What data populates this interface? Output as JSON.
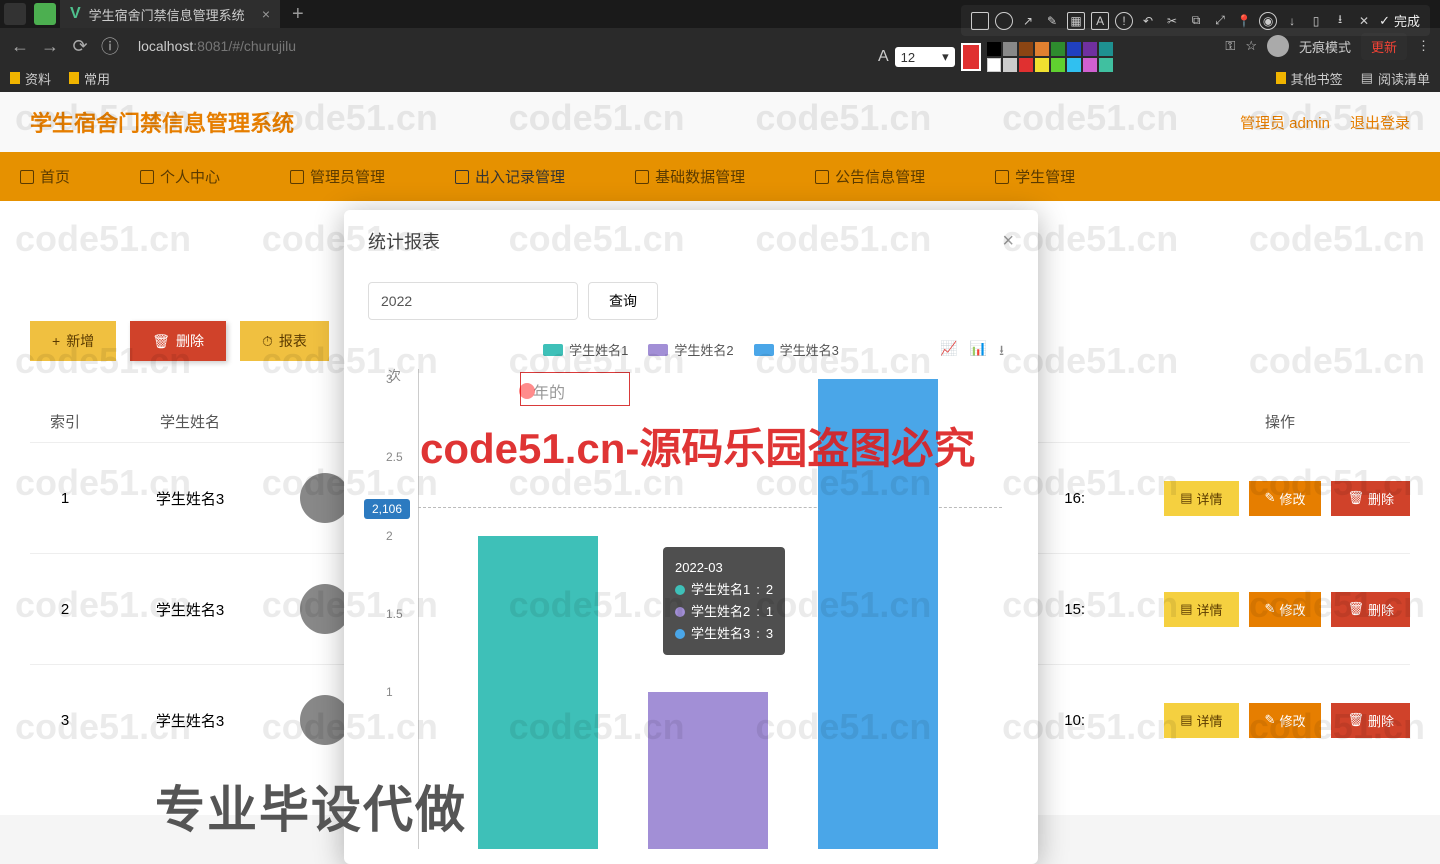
{
  "browser": {
    "tab_title": "学生宿舍门禁信息管理系统",
    "url_host": "localhost",
    "url_port": ":8081",
    "url_path": "/#/churujilu",
    "incognito": "无痕模式",
    "update": "更新",
    "bookmarks": [
      "资料",
      "常用"
    ],
    "right_bookmarks": [
      "其他书签",
      "阅读清单"
    ],
    "toolbar_fontsize": "12",
    "done_label": "完成"
  },
  "app": {
    "title": "学生宿舍门禁信息管理系统",
    "role": "管理员",
    "user": "admin",
    "logout": "退出登录",
    "nav": [
      {
        "label": "首页"
      },
      {
        "label": "个人中心"
      },
      {
        "label": "管理员管理"
      },
      {
        "label": "出入记录管理"
      },
      {
        "label": "基础数据管理"
      },
      {
        "label": "公告信息管理"
      },
      {
        "label": "学生管理"
      }
    ],
    "buttons": {
      "add": "新增",
      "delete": "删除",
      "report": "报表"
    },
    "columns": {
      "index": "索引",
      "name": "学生姓名",
      "ops": "操作"
    },
    "rows": [
      {
        "idx": "1",
        "name": "学生姓名3",
        "time": "16:"
      },
      {
        "idx": "2",
        "name": "学生姓名3",
        "time": "15:"
      },
      {
        "idx": "3",
        "name": "学生姓名3",
        "time": "10:"
      }
    ],
    "op_labels": {
      "detail": "详情",
      "edit": "修改",
      "delete": "删除"
    }
  },
  "modal": {
    "title": "统计报表",
    "year_input": "2022",
    "query": "查询",
    "year_suffix": "年的",
    "value_bubble": "2,106"
  },
  "chart_data": {
    "type": "bar",
    "title": "",
    "ylabel": "次",
    "xlabel": "",
    "ylim": [
      0,
      3
    ],
    "yticks": [
      "3",
      "2.5",
      "2",
      "1.5",
      "1"
    ],
    "categories": [
      "2022-03"
    ],
    "series": [
      {
        "name": "学生姓名1",
        "color": "#3ec0b8",
        "values": [
          2
        ]
      },
      {
        "name": "学生姓名2",
        "color": "#a28fd6",
        "values": [
          1
        ]
      },
      {
        "name": "学生姓名3",
        "color": "#4aa6e8",
        "values": [
          3
        ]
      }
    ],
    "tooltip": {
      "title": "2022-03",
      "items": [
        {
          "label": "学生姓名1",
          "value": "2",
          "color": "#3ec0b8"
        },
        {
          "label": "学生姓名2",
          "value": "1",
          "color": "#a28fd6"
        },
        {
          "label": "学生姓名3",
          "value": "3",
          "color": "#4aa6e8"
        }
      ]
    }
  },
  "watermark": {
    "text": "code51.cn",
    "big": "code51.cn-源码乐园盗图必究",
    "bottom": "专业毕设代做"
  }
}
